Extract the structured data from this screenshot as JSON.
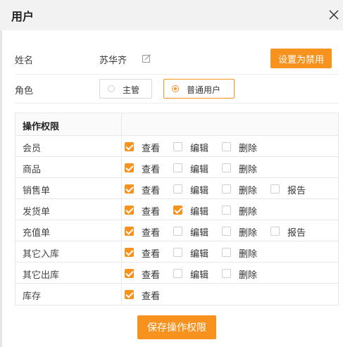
{
  "dialog": {
    "title": "用户",
    "close_icon": "close-icon"
  },
  "user": {
    "name_label": "姓名",
    "name_value": "苏华齐",
    "edit_icon": "edit-icon",
    "disable_button": "设置为禁用",
    "role_label": "角色",
    "roles": [
      {
        "label": "主管",
        "selected": false
      },
      {
        "label": "普通用户",
        "selected": true
      }
    ]
  },
  "permissions": {
    "header": "操作权限",
    "rows": [
      {
        "name": "会员",
        "items": [
          {
            "label": "查看",
            "checked": true
          },
          {
            "label": "编辑",
            "checked": false
          },
          {
            "label": "删除",
            "checked": false
          }
        ]
      },
      {
        "name": "商品",
        "items": [
          {
            "label": "查看",
            "checked": true
          },
          {
            "label": "编辑",
            "checked": false
          },
          {
            "label": "删除",
            "checked": false
          }
        ]
      },
      {
        "name": "销售单",
        "items": [
          {
            "label": "查看",
            "checked": true
          },
          {
            "label": "编辑",
            "checked": false
          },
          {
            "label": "删除",
            "checked": false
          },
          {
            "label": "报告",
            "checked": false
          }
        ]
      },
      {
        "name": "发货单",
        "items": [
          {
            "label": "查看",
            "checked": true
          },
          {
            "label": "编辑",
            "checked": true
          },
          {
            "label": "删除",
            "checked": false
          }
        ]
      },
      {
        "name": "充值单",
        "items": [
          {
            "label": "查看",
            "checked": true
          },
          {
            "label": "编辑",
            "checked": false
          },
          {
            "label": "删除",
            "checked": false
          },
          {
            "label": "报告",
            "checked": false
          }
        ]
      },
      {
        "name": "其它入库",
        "items": [
          {
            "label": "查看",
            "checked": true
          },
          {
            "label": "编辑",
            "checked": false
          },
          {
            "label": "删除",
            "checked": false
          }
        ]
      },
      {
        "name": "其它出库",
        "items": [
          {
            "label": "查看",
            "checked": true
          },
          {
            "label": "编辑",
            "checked": false
          },
          {
            "label": "删除",
            "checked": false
          }
        ]
      },
      {
        "name": "库存",
        "items": [
          {
            "label": "查看",
            "checked": true
          }
        ]
      }
    ],
    "save_button": "保存操作权限"
  },
  "colors": {
    "accent": "#f7921e",
    "header_bg": "#f2f2f2",
    "border": "#e8e8e8"
  }
}
